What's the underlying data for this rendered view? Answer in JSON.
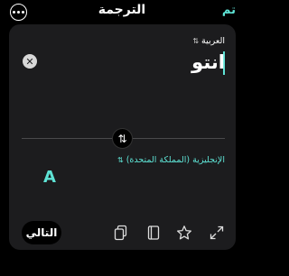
{
  "header": {
    "title": "الترجمة",
    "done_label": "تم"
  },
  "source": {
    "language": "العربية",
    "text": "انتو"
  },
  "target": {
    "language": "الإنجليزية (المملكة المتحدة)",
    "text": "A"
  },
  "footer": {
    "next_label": "التالي"
  },
  "colors": {
    "accent": "#5ee3d5",
    "panel": "#1c1c1e"
  }
}
